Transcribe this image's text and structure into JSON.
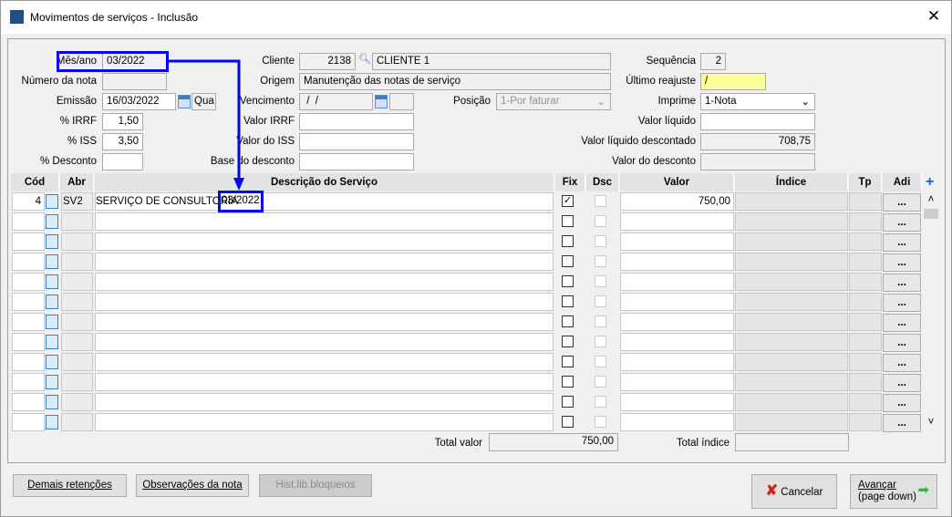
{
  "window": {
    "title": "Movimentos de serviços - Inclusão",
    "close": "✕"
  },
  "form": {
    "mes_ano": {
      "label": "Mês/ano",
      "value": "03/2022"
    },
    "numero_nota": {
      "label": "Número da nota",
      "value": ""
    },
    "emissao": {
      "label": "Emissão",
      "value": "16/03/2022",
      "weekday": "Qua"
    },
    "irrf_pct": {
      "label": "% IRRF",
      "value": "1,50"
    },
    "iss_pct": {
      "label": "% ISS",
      "value": "3,50"
    },
    "desconto_pct": {
      "label": "% Desconto",
      "value": ""
    },
    "cliente": {
      "label": "Cliente",
      "code": "2138",
      "name": "CLIENTE 1"
    },
    "origem": {
      "label": "Origem",
      "value": "Manutenção das notas de serviço"
    },
    "vencimento": {
      "label": "Vencimento",
      "value": " /  /"
    },
    "posicao": {
      "label": "Posição",
      "value": "1-Por faturar"
    },
    "valor_irrf": {
      "label": "Valor IRRF",
      "value": ""
    },
    "valor_iss": {
      "label": "Valor do ISS",
      "value": ""
    },
    "base_desconto": {
      "label": "Base do desconto",
      "value": ""
    },
    "sequencia": {
      "label": "Sequência",
      "value": "2"
    },
    "ultimo_reajuste": {
      "label": "Último reajuste",
      "value": "/"
    },
    "imprime": {
      "label": "Imprime",
      "value": "1-Nota"
    },
    "valor_liquido": {
      "label": "Valor líquido",
      "value": ""
    },
    "valor_liquido_desc": {
      "label": "Valor líquido descontado",
      "value": "708,75"
    },
    "valor_desconto": {
      "label": "Valor do desconto",
      "value": ""
    }
  },
  "grid": {
    "columns": {
      "cod": "Cód",
      "abr": "Abr",
      "desc": "Descrição do Serviço",
      "fix": "Fix",
      "dsc": "Dsc",
      "valor": "Valor",
      "indice": "Índice",
      "tp": "Tp",
      "adi": "Adi"
    },
    "rows": [
      {
        "cod": "4",
        "abr": "SV2",
        "desc": "SERVIÇO DE CONSULTORIA",
        "desc_highlight": "03/2022",
        "fix": true,
        "valor": "750,00",
        "adi": "..."
      }
    ],
    "empty_adi": "...",
    "add": "+"
  },
  "totals": {
    "valor_label": "Total valor",
    "valor": "750,00",
    "indice_label": "Total índice",
    "indice": ""
  },
  "buttons": {
    "demais": "Demais retenções",
    "obs": "Observações da nota",
    "hist": "Hist.lib.bloqueios",
    "cancelar": "Cancelar",
    "avancar1": "Avançar",
    "avancar2": "(page down)"
  },
  "colors": {
    "annotation": "#0000ff",
    "highlight": "#ffff99"
  }
}
